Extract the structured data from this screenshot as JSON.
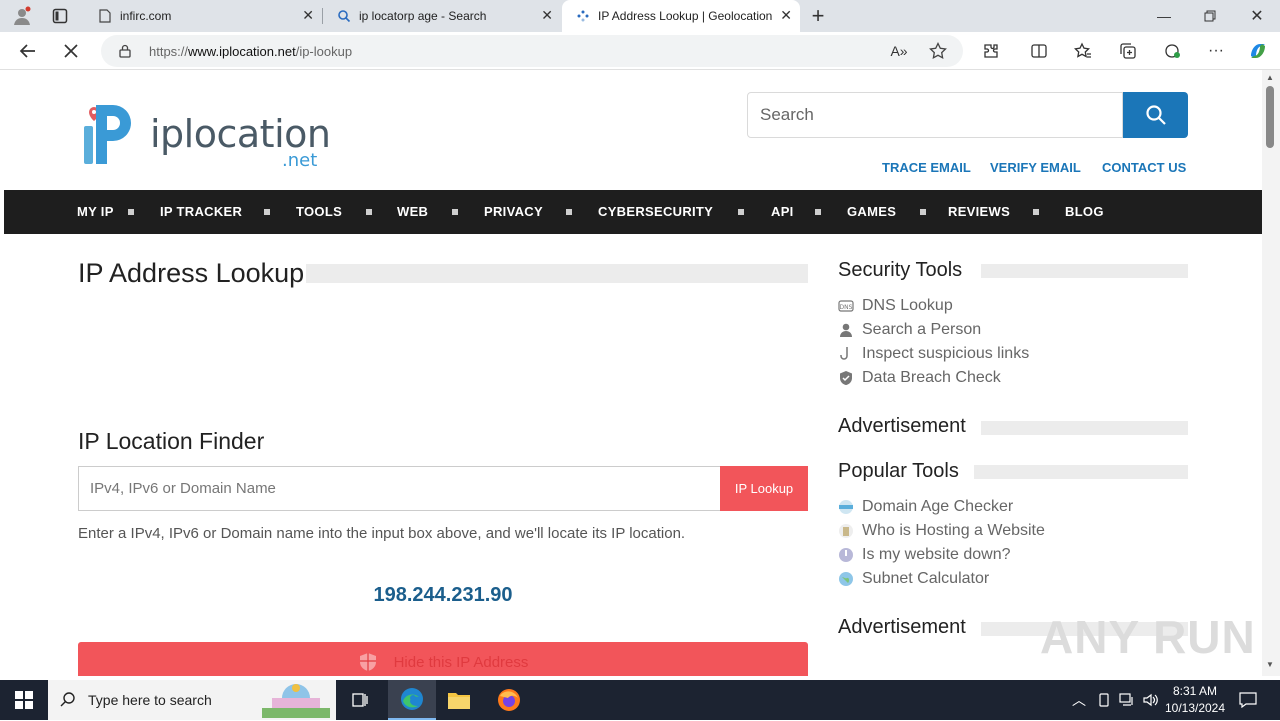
{
  "browser": {
    "tabs": [
      {
        "label": "infirc.com",
        "icon": "page-icon"
      },
      {
        "label": "ip locatorp age - Search",
        "icon": "search-icon"
      },
      {
        "label": "IP Address Lookup | Geolocation",
        "icon": "loading-icon"
      }
    ],
    "url_prefix": "https://",
    "url_domain": "www.iplocation.net",
    "url_path": "/ip-lookup"
  },
  "site": {
    "logo_main": "iplocation",
    "logo_sub": ".net",
    "search_placeholder": "Search",
    "top_links": [
      "TRACE EMAIL",
      "VERIFY EMAIL",
      "CONTACT US"
    ],
    "nav": [
      "MY IP",
      "IP TRACKER",
      "TOOLS",
      "WEB",
      "PRIVACY",
      "CYBERSECURITY",
      "API",
      "GAMES",
      "REVIEWS",
      "BLOG"
    ],
    "accent": "#1b76b8",
    "button_red": "#f2555a"
  },
  "main": {
    "title": "IP Address Lookup",
    "finder_title": "IP Location Finder",
    "input_placeholder": "IPv4, IPv6 or Domain Name",
    "lookup_button": "IP Lookup",
    "help_text": "Enter a IPv4, IPv6 or Domain name into the input box above, and we'll locate its IP location.",
    "current_ip": "198.244.231.90",
    "hide_button": "Hide this IP Address"
  },
  "sidebar": {
    "security_title": "Security Tools",
    "security_items": [
      "DNS Lookup",
      "Search a Person",
      "Inspect suspicious links",
      "Data Breach Check"
    ],
    "ad1": "Advertisement",
    "popular_title": "Popular Tools",
    "popular_items": [
      "Domain Age Checker",
      "Who is Hosting a Website",
      "Is my website down?",
      "Subnet Calculator"
    ],
    "ad2": "Advertisement"
  },
  "watermark": "ANY RUN",
  "taskbar": {
    "search_placeholder": "Type here to search",
    "time": "8:31 AM",
    "date": "10/13/2024"
  }
}
